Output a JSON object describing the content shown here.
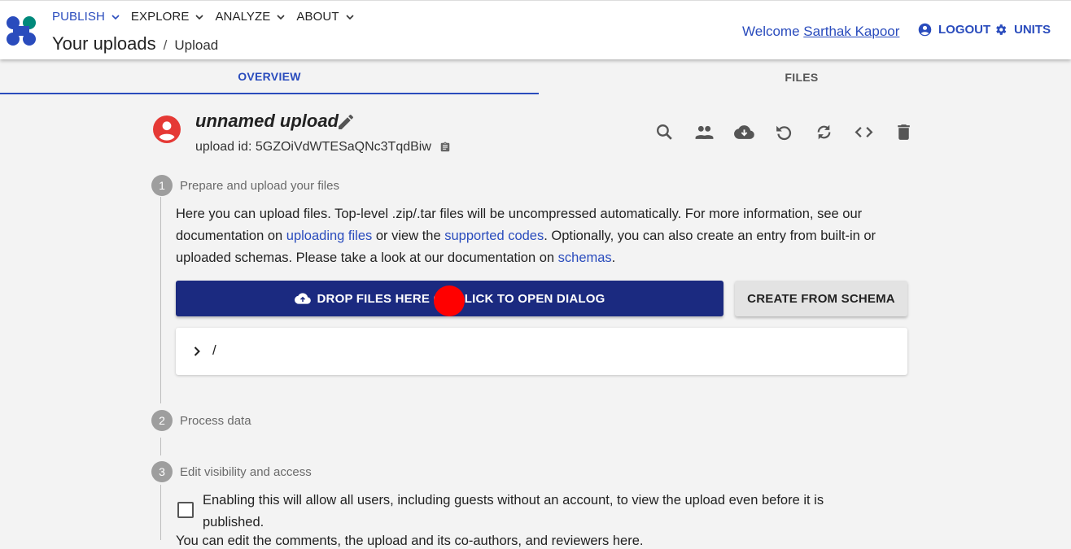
{
  "nav": {
    "items": [
      {
        "label": "PUBLISH",
        "active": true
      },
      {
        "label": "EXPLORE",
        "active": false
      },
      {
        "label": "ANALYZE",
        "active": false
      },
      {
        "label": "ABOUT",
        "active": false
      }
    ]
  },
  "breadcrumb": {
    "title": "Your uploads",
    "separator": "/",
    "page": "Upload"
  },
  "header": {
    "welcome_prefix": "Welcome",
    "user_name": "Sarthak Kapoor",
    "logout_label": "LOGOUT",
    "units_label": "UNITS"
  },
  "tabs": [
    {
      "label": "OVERVIEW",
      "active": true
    },
    {
      "label": "FILES",
      "active": false
    }
  ],
  "upload": {
    "name": "unnamed upload",
    "id_label": "upload id:",
    "id_value": "5GZOiVdWTESaQNc3TqdBiw"
  },
  "actions": [
    "search-icon",
    "members-icon",
    "cloud-download-icon",
    "undo-icon",
    "reprocess-icon",
    "api-code-icon",
    "delete-icon"
  ],
  "steps": {
    "step1": {
      "num": "1",
      "label": "Prepare and upload your files"
    },
    "step2": {
      "num": "2",
      "label": "Process data"
    },
    "step3": {
      "num": "3",
      "label": "Edit visibility and access"
    }
  },
  "description": {
    "part1": "Here you can upload files. Top-level .zip/.tar files will be uncompressed automatically. For more information, see our documentation on ",
    "link1": "uploading files",
    "part2": " or view the ",
    "link2": "supported codes",
    "part3": ". Optionally, you can also create an entry from built-in or uploaded schemas. Please take a look at our documentation on ",
    "link3": "schemas",
    "part4": "."
  },
  "buttons": {
    "drop_label": "DROP FILES HERE OR CLICK TO OPEN DIALOG",
    "schema_label": "CREATE FROM SCHEMA"
  },
  "tree": {
    "path": "/"
  },
  "visibility": {
    "checkbox_text": "Enabling this will allow all users, including guests without an account, to view the upload even before it is published.",
    "next_text": "You can edit the comments, the upload and its co-authors, and reviewers here."
  },
  "colors": {
    "accent": "#2a4cbd",
    "primary_button": "#1b2a80",
    "avatar_red": "#e53935"
  }
}
